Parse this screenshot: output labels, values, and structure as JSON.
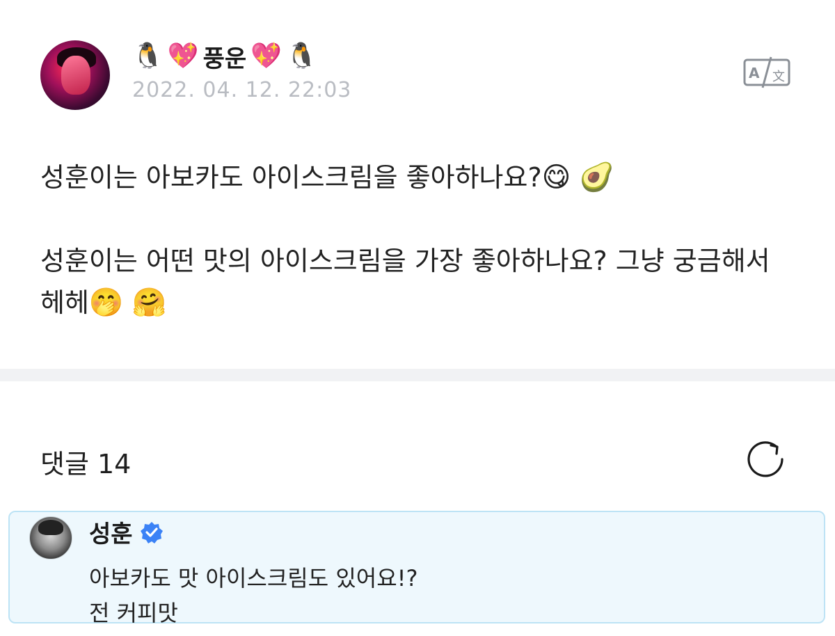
{
  "post": {
    "author": {
      "emoji_left": [
        "🐧",
        "💖"
      ],
      "name": "풍운",
      "emoji_right": [
        "💖",
        "🐧"
      ]
    },
    "timestamp": "2022. 04. 12. 22:03",
    "translate_icon": "translate-icon",
    "body": {
      "para1_text": "성훈이는 아보카도 아이스크림을 좋아하나요?",
      "para1_emoji": [
        "😋",
        "🥑"
      ],
      "para2_text": "성훈이는 어떤 맛의 아이스크림을 가장 좋아하나요? 그냥 궁금해서 헤헤",
      "para2_emoji": [
        "🤭",
        "🤗"
      ]
    }
  },
  "comments": {
    "label": "댓글 14",
    "refresh_icon": "refresh-icon",
    "items": [
      {
        "name": "성훈",
        "verified_icon": "verified-badge-icon",
        "line1": "아보카도 맛 아이스크림도 있어요!?",
        "line2": "전 커피맛"
      }
    ]
  },
  "colors": {
    "timestamp": "#b9bcc2",
    "comment_bg": "#eef8fd",
    "comment_border": "#bde3f5",
    "verified": "#3b82f6",
    "divider": "#f1f2f4"
  }
}
